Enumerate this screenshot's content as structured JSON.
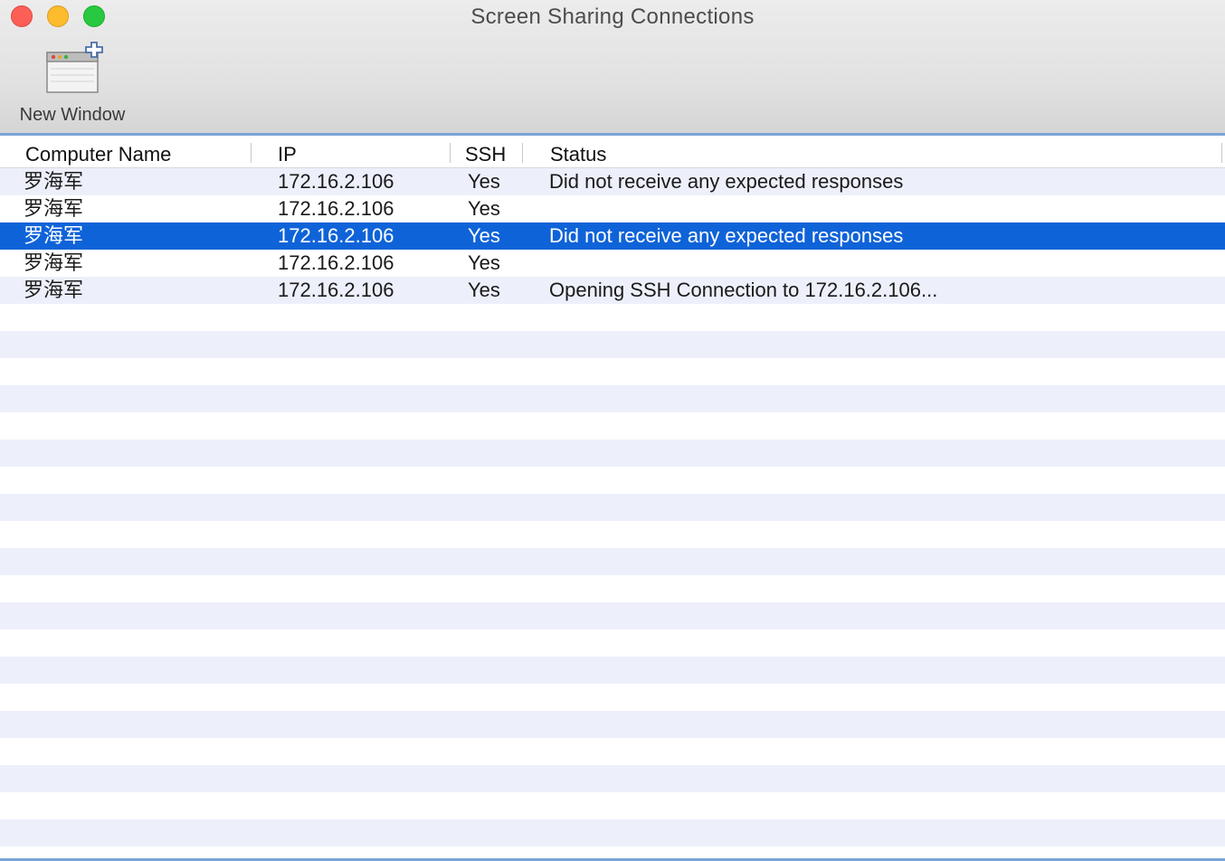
{
  "window": {
    "title": "Screen Sharing Connections"
  },
  "toolbar": {
    "new_window_label": "New Window",
    "new_window_icon": "new-window-icon"
  },
  "table": {
    "columns": [
      "Computer Name",
      "IP",
      "SSH",
      "Status"
    ],
    "rows": [
      {
        "name": "罗海军",
        "ip": "172.16.2.106",
        "ssh": "Yes",
        "status": "Did not receive any expected responses",
        "selected": false
      },
      {
        "name": "罗海军",
        "ip": "172.16.2.106",
        "ssh": "Yes",
        "status": "",
        "selected": false
      },
      {
        "name": "罗海军",
        "ip": "172.16.2.106",
        "ssh": "Yes",
        "status": "Did not receive any expected responses",
        "selected": true
      },
      {
        "name": "罗海军",
        "ip": "172.16.2.106",
        "ssh": "Yes",
        "status": "",
        "selected": false
      },
      {
        "name": "罗海军",
        "ip": "172.16.2.106",
        "ssh": "Yes",
        "status": "Opening SSH Connection to 172.16.2.106...",
        "selected": false
      }
    ]
  },
  "colors": {
    "selection": "#0f63d8",
    "stripe": "#edf0fb",
    "accent": "#7aa3d6"
  }
}
